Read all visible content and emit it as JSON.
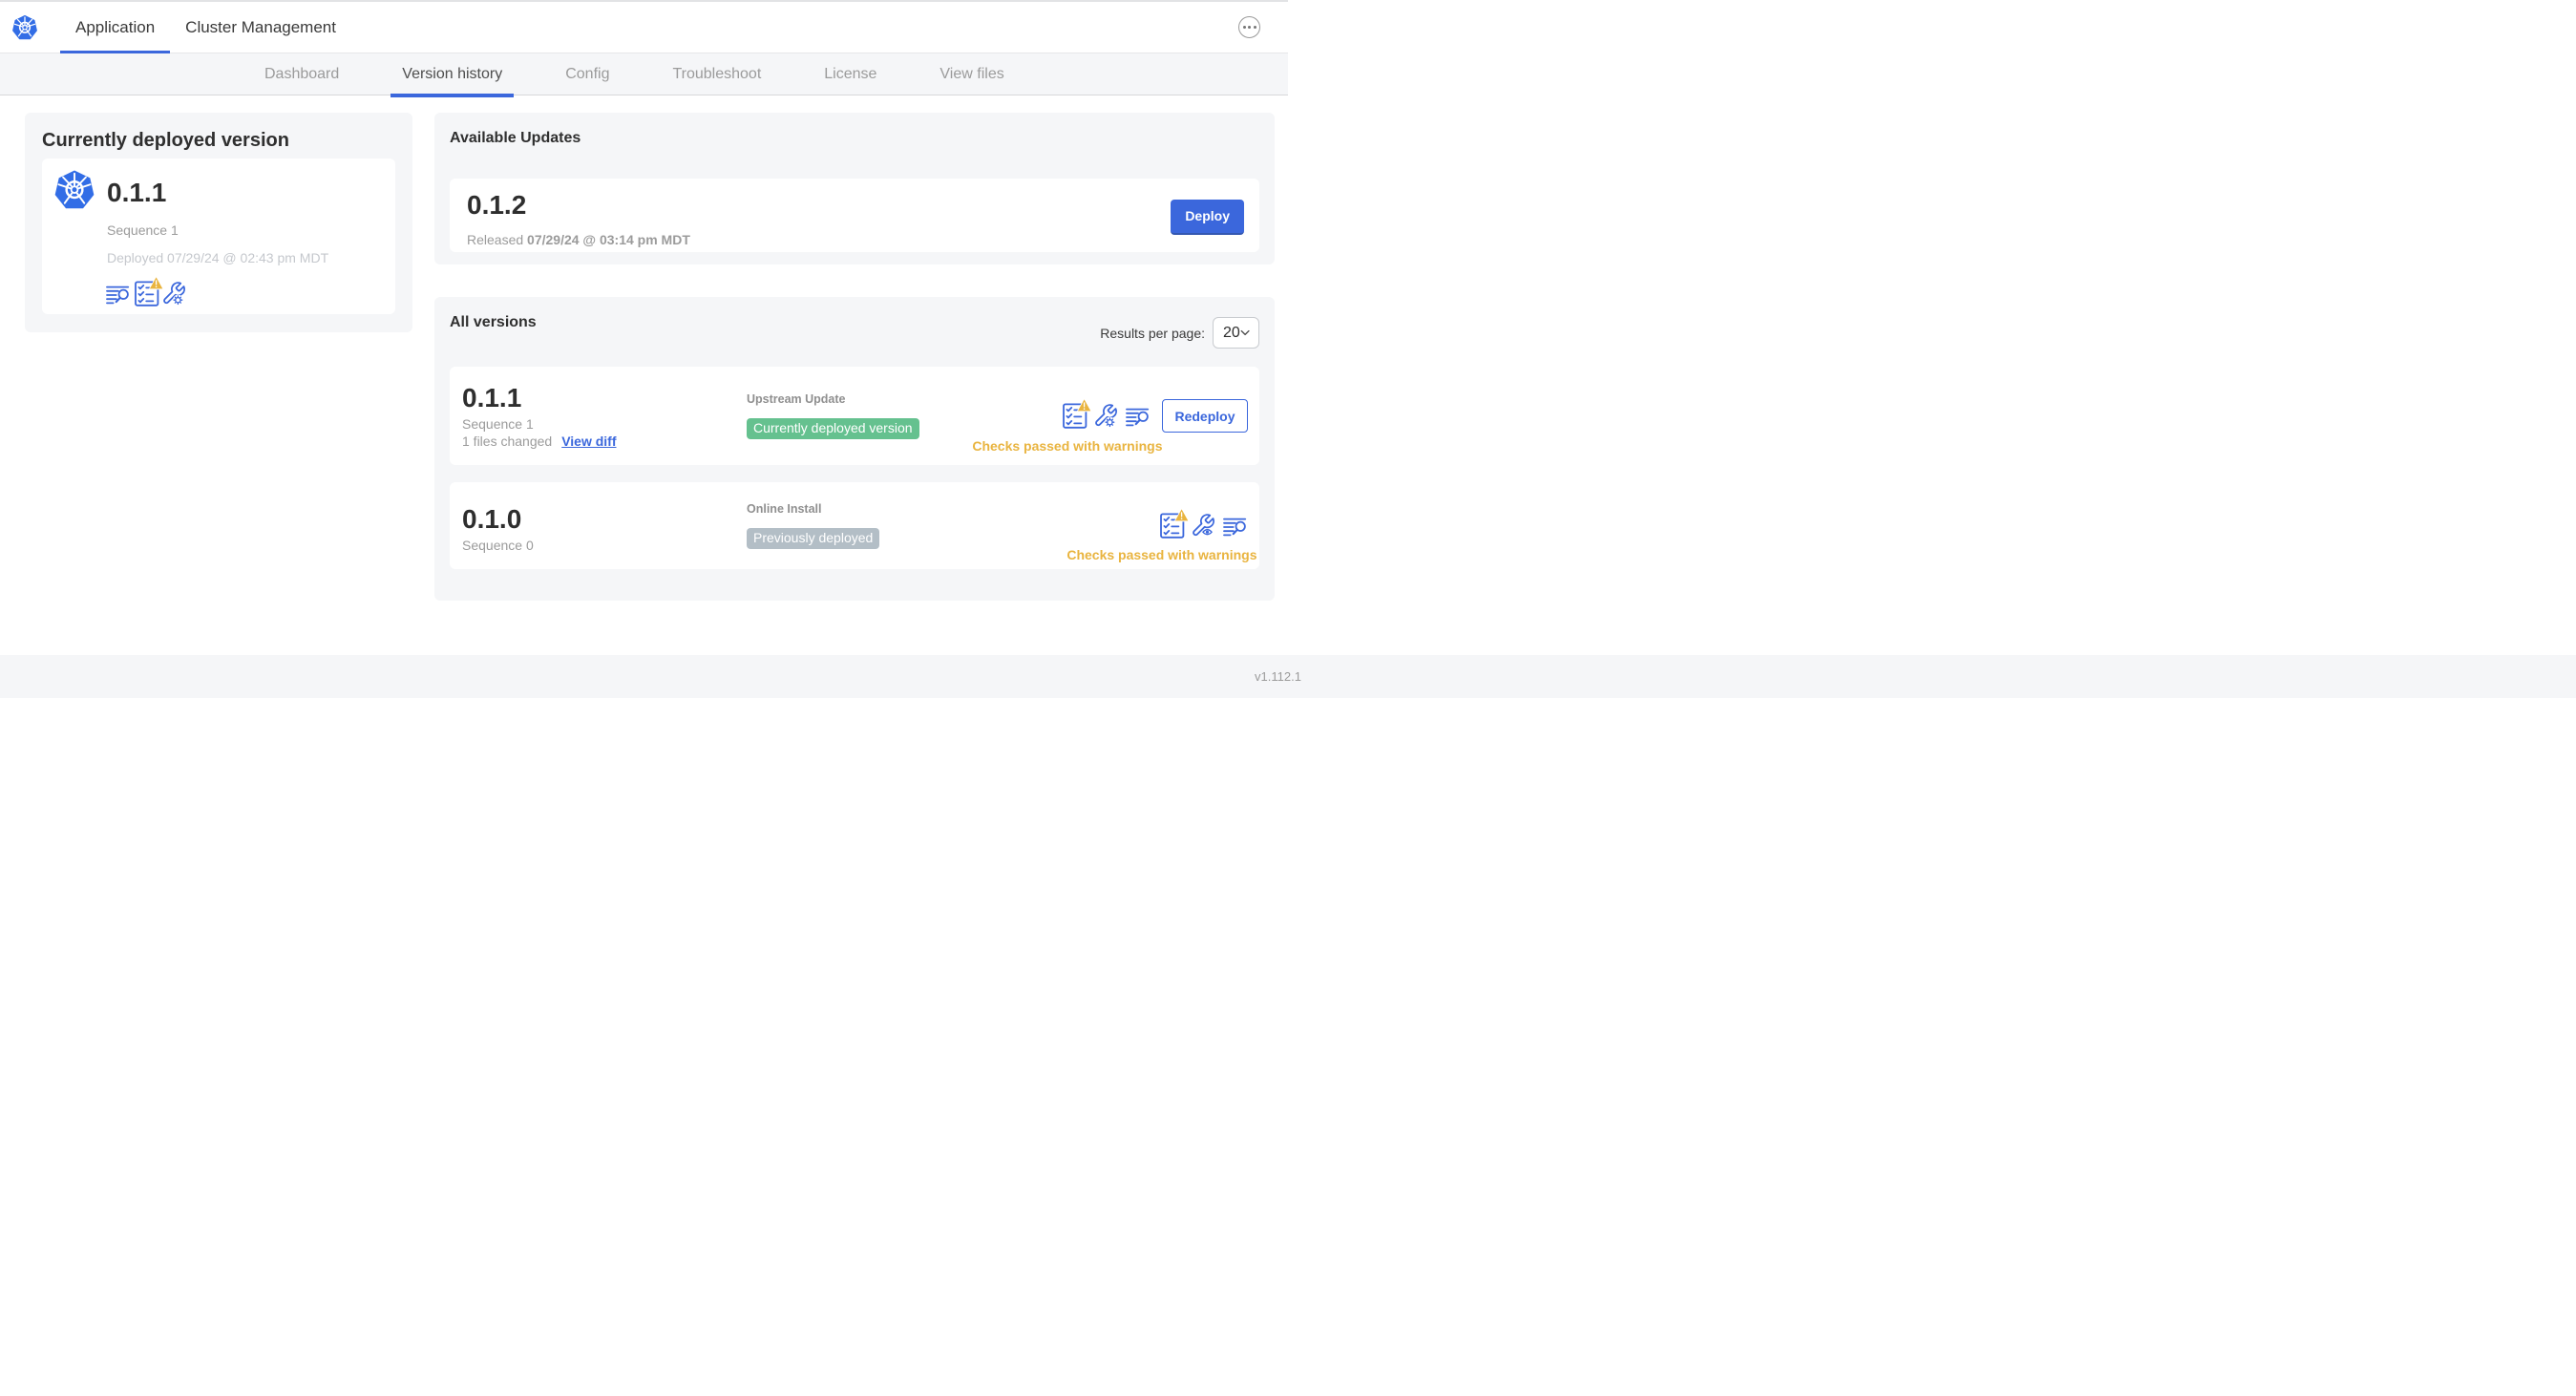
{
  "colors": {
    "accent": "#3b67dc",
    "k8s_blue": "#326de6",
    "amber": "#e9b43f",
    "green": "#65c18f",
    "gray_badge": "#b3bec6",
    "panel_gray": "#f5f6f8"
  },
  "header": {
    "tabs": [
      {
        "label": "Application",
        "active": true
      },
      {
        "label": "Cluster Management",
        "active": false
      }
    ],
    "menu_icon": "ellipsis-icon"
  },
  "subnav": {
    "tabs": [
      {
        "label": "Dashboard",
        "active": false
      },
      {
        "label": "Version history",
        "active": true
      },
      {
        "label": "Config",
        "active": false
      },
      {
        "label": "Troubleshoot",
        "active": false
      },
      {
        "label": "License",
        "active": false
      },
      {
        "label": "View files",
        "active": false
      }
    ]
  },
  "current_deployed": {
    "title": "Currently deployed version",
    "version": "0.1.1",
    "sequence": "Sequence 1",
    "deployed": "Deployed 07/29/24 @ 02:43 pm MDT",
    "icons": [
      "release-notes-icon",
      "preflight-checks-warning-icon",
      "edit-config-icon"
    ]
  },
  "available_updates": {
    "title": "Available Updates",
    "version": "0.1.2",
    "released_prefix": "Released",
    "released_date": "07/29/24 @ 03:14 pm MDT",
    "deploy_label": "Deploy"
  },
  "all_versions": {
    "title": "All versions",
    "results_per_page_label": "Results per page:",
    "results_per_page_value": "20",
    "rows": [
      {
        "version": "0.1.1",
        "sequence": "Sequence 1",
        "files_changed": "1 files changed",
        "view_diff_label": "View diff",
        "source": "Upstream Update",
        "badge": "Currently deployed version",
        "badge_color": "green",
        "status": "Checks passed with warnings",
        "action_label": "Redeploy",
        "icons": [
          "preflight-checks-warning-icon",
          "edit-config-icon",
          "release-notes-icon"
        ]
      },
      {
        "version": "0.1.0",
        "sequence": "Sequence 0",
        "source": "Online Install",
        "badge": "Previously deployed",
        "badge_color": "gray",
        "status": "Checks passed with warnings",
        "icons": [
          "preflight-checks-warning-icon",
          "view-config-icon",
          "release-notes-icon"
        ]
      }
    ]
  },
  "footer": {
    "version": "v1.112.1"
  }
}
